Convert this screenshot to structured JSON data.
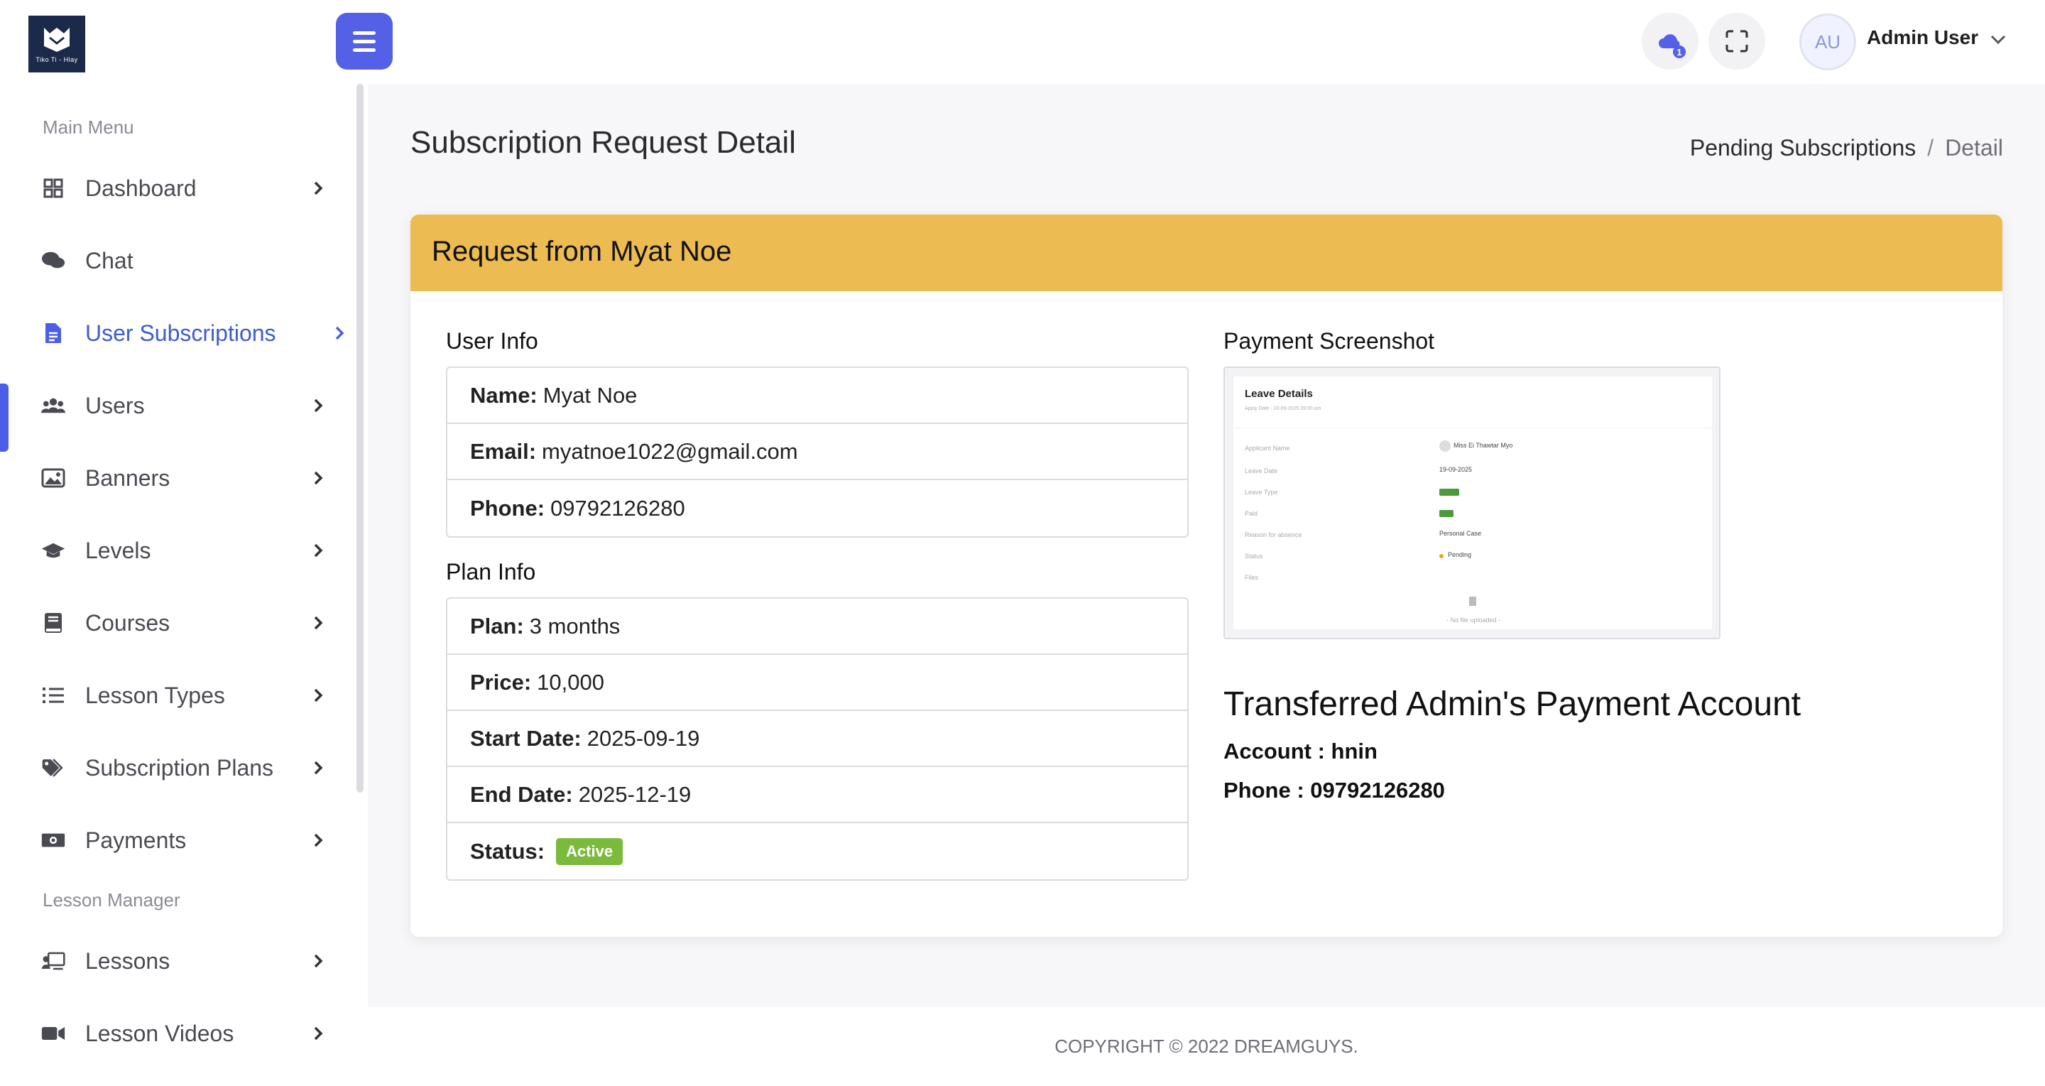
{
  "header": {
    "logo_text": "Tiko Ti - Hlay",
    "notification_count": "1",
    "avatar_initials": "AU",
    "user_name": "Admin User"
  },
  "sidebar": {
    "main_menu_title": "Main Menu",
    "lesson_manager_title": "Lesson Manager",
    "items": [
      {
        "label": "Dashboard",
        "icon": "grid-icon"
      },
      {
        "label": "Chat",
        "icon": "chat-icon"
      },
      {
        "label": "User Subscriptions",
        "icon": "document-icon",
        "active": true
      },
      {
        "label": "Users",
        "icon": "users-icon"
      },
      {
        "label": "Banners",
        "icon": "image-icon"
      },
      {
        "label": "Levels",
        "icon": "graduation-cap-icon"
      },
      {
        "label": "Courses",
        "icon": "book-icon"
      },
      {
        "label": "Lesson Types",
        "icon": "list-icon"
      },
      {
        "label": "Subscription Plans",
        "icon": "tags-icon"
      },
      {
        "label": "Payments",
        "icon": "money-icon"
      },
      {
        "label": "Lessons",
        "icon": "chalkboard-icon"
      },
      {
        "label": "Lesson Videos",
        "icon": "video-icon"
      }
    ]
  },
  "page": {
    "title": "Subscription Request Detail",
    "breadcrumb": {
      "link": "Pending Subscriptions",
      "separator": "/",
      "current": "Detail"
    }
  },
  "card": {
    "header": "Request from Myat Noe",
    "user_info_title": "User Info",
    "user_info": {
      "name_label": "Name:",
      "name": "Myat Noe",
      "email_label": "Email:",
      "email": "myatnoe1022@gmail.com",
      "phone_label": "Phone:",
      "phone": "09792126280"
    },
    "plan_info_title": "Plan Info",
    "plan_info": {
      "plan_label": "Plan:",
      "plan": "3 months",
      "price_label": "Price:",
      "price": "10,000",
      "start_label": "Start Date:",
      "start": "2025-09-19",
      "end_label": "End Date:",
      "end": "2025-12-19",
      "status_label": "Status:",
      "status": "Active"
    },
    "payment_screenshot_title": "Payment Screenshot",
    "screenshot": {
      "title": "Leave Details",
      "subtitle": "Apply Date - 10-09-2025 09:00 am",
      "rows": [
        {
          "label": "Applicant Name",
          "value": "Miss Ei Thawtar Myo"
        },
        {
          "label": "Leave Date",
          "value": "19-09-2025"
        },
        {
          "label": "Leave Type",
          "value": ""
        },
        {
          "label": "Paid",
          "value": ""
        },
        {
          "label": "Reason for absence",
          "value": "Personal Case"
        },
        {
          "label": "Status",
          "value": "Pending"
        },
        {
          "label": "Files",
          "value": ""
        }
      ],
      "no_file": "- No file uploaded -"
    },
    "transferred_title": "Transferred Admin's Payment Account",
    "account_line": "Account : hnin",
    "phone_line": "Phone : 09792126280"
  },
  "footer": {
    "copyright": "COPYRIGHT © 2022 DREAMGUYS."
  },
  "colors": {
    "accent": "#5460e6",
    "card_header": "#ecbb51",
    "badge_active": "#7cba3d"
  }
}
